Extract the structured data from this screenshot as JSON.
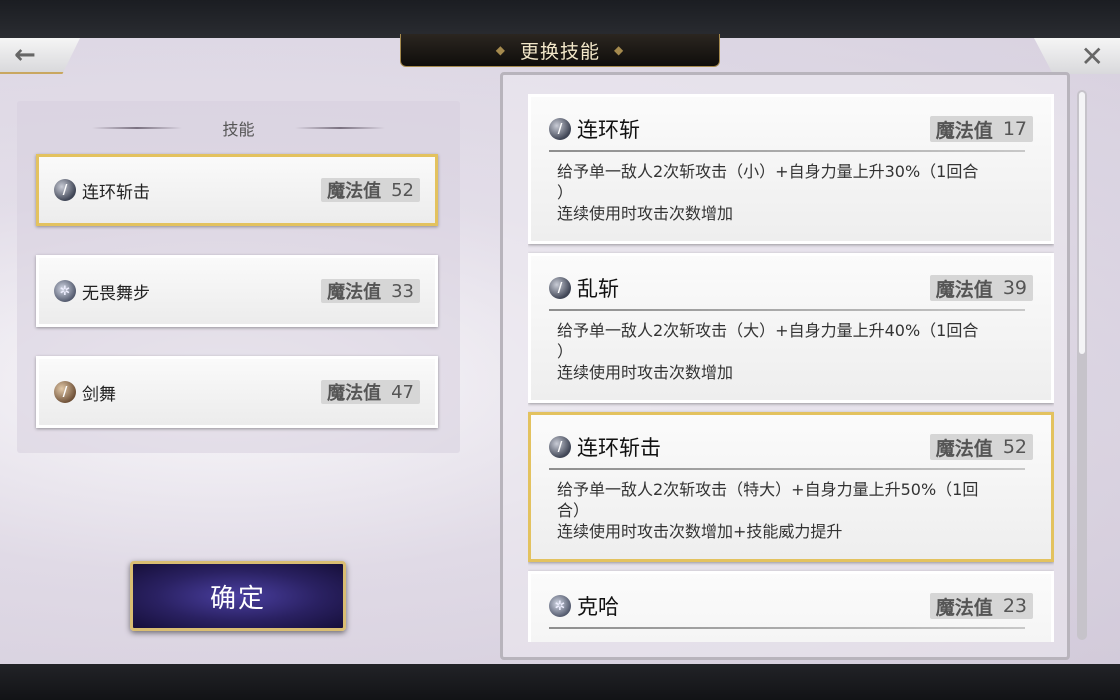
{
  "header": {
    "title": "更换技能",
    "back_glyph": "←",
    "close_glyph": "✕"
  },
  "left": {
    "section_title": "技能",
    "skills": [
      {
        "name": "连环斩击",
        "mp_label": "魔法值",
        "mp": "52",
        "icon": "slash-icon",
        "selected": true
      },
      {
        "name": "无畏舞步",
        "mp_label": "魔法值",
        "mp": "33",
        "icon": "star-icon",
        "selected": false
      },
      {
        "name": "剑舞",
        "mp_label": "魔法值",
        "mp": "47",
        "icon": "dance-icon",
        "selected": false
      }
    ],
    "confirm_label": "确定"
  },
  "right": {
    "skills": [
      {
        "name": "连环斩",
        "mp_label": "魔法值",
        "mp": "17",
        "icon": "slash-icon",
        "selected": false,
        "desc": "给予单一敌人2次斩攻击（小）+自身力量上升30%（1回合\n）\n连续使用时攻击次数增加"
      },
      {
        "name": "乱斩",
        "mp_label": "魔法值",
        "mp": "39",
        "icon": "slash-icon",
        "selected": false,
        "desc": "给予单一敌人2次斩攻击（大）+自身力量上升40%（1回合\n）\n连续使用时攻击次数增加"
      },
      {
        "name": "连环斩击",
        "mp_label": "魔法值",
        "mp": "52",
        "icon": "slash-icon",
        "selected": true,
        "desc": "给予单一敌人2次斩攻击（特大）+自身力量上升50%（1回\n合）\n连续使用时攻击次数增加+技能威力提升"
      },
      {
        "name": "克哈",
        "mp_label": "魔法值",
        "mp": "23",
        "icon": "star-icon",
        "selected": false,
        "desc": ""
      }
    ]
  },
  "colors": {
    "selected_border": "#e3c25f",
    "confirm_bg": "#2a2162",
    "title_text": "#f1e6c8"
  }
}
